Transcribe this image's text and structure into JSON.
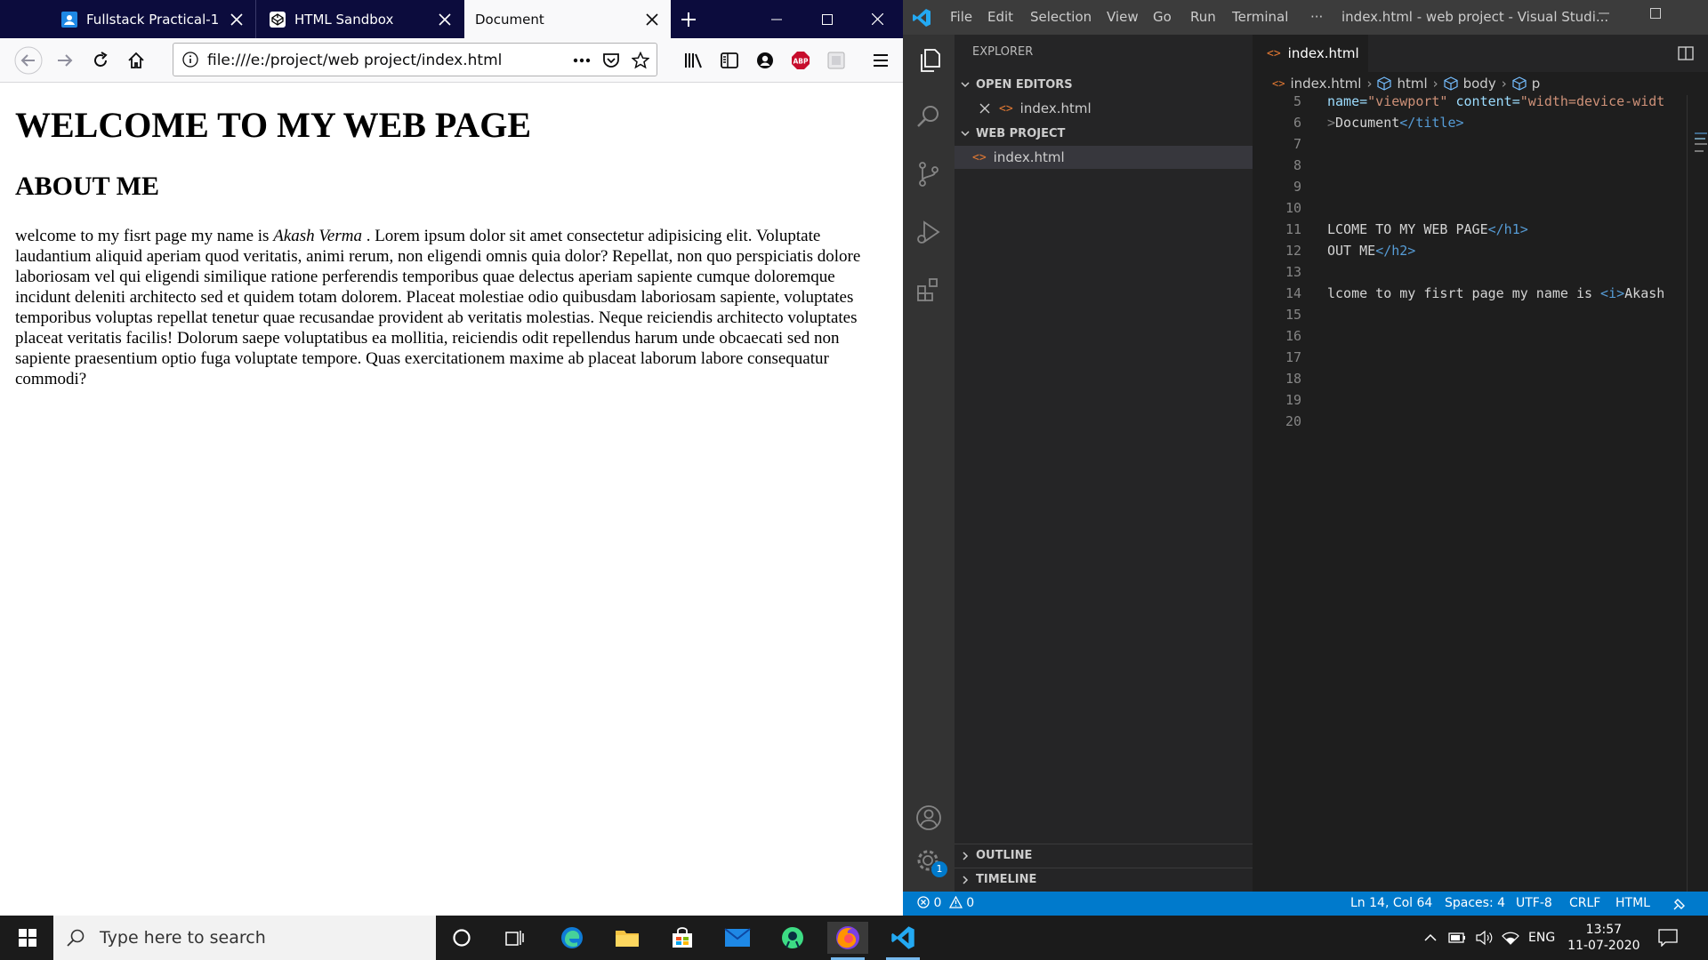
{
  "firefox": {
    "tabs": [
      {
        "title": "Fullstack Practical-1"
      },
      {
        "title": "HTML Sandbox"
      },
      {
        "title": "Document"
      }
    ],
    "url": "file:///e:/project/web project/index.html",
    "page": {
      "h1": "WELCOME TO MY WEB PAGE",
      "h2": "ABOUT ME",
      "para_before": "welcome to my fisrt page my name is ",
      "para_italic": "Akash Verma",
      "para_after": " . Lorem ipsum dolor sit amet consectetur adipisicing elit. Voluptate laudantium aliquid aperiam quod veritatis, animi rerum, non eligendi omnis quia dolor? Repellat, non quo perspiciatis dolore laboriosam vel qui eligendi similique ratione perferendis temporibus quae delectus aperiam sapiente cumque doloremque incidunt deleniti architecto sed et quidem totam dolorem. Placeat molestiae odio quibusdam laboriosam sapiente, voluptates temporibus voluptas repellat tenetur quae recusandae provident ab veritatis molestias. Neque reiciendis architecto voluptates placeat veritatis facilis! Dolorum saepe voluptatibus ea mollitia, reiciendis odit repellendus harum unde obcaecati sed non sapiente praesentium optio fuga voluptate tempore. Quas exercitationem maxime ab placeat laborum labore consequatur commodi?"
    }
  },
  "vscode": {
    "menu": [
      "File",
      "Edit",
      "Selection",
      "View",
      "Go",
      "Run",
      "Terminal"
    ],
    "more": "···",
    "window_title": "index.html - web project - Visual Studi...",
    "explorer": {
      "title": "EXPLORER",
      "open_editors": "OPEN EDITORS",
      "open_file": "index.html",
      "project": "WEB PROJECT",
      "project_file": "index.html",
      "outline": "OUTLINE",
      "timeline": "TIMELINE"
    },
    "tab": "index.html",
    "breadcrumb": [
      "index.html",
      "html",
      "body",
      "p"
    ],
    "code": {
      "l5": "5",
      "l6": "6",
      "l7": "7",
      "l8": "8",
      "l9": "9",
      "l10": "10",
      "l11": "11",
      "l12": "12",
      "l13": "13",
      "l14": "14",
      "l15": "15",
      "l16": "16",
      "l17": "17",
      "l18": "18",
      "l19": "19",
      "l20": "20",
      "c5_attr1": "name=",
      "c5_val1": "\"viewport\"",
      "c5_attr2": " content=",
      "c5_val2": "\"width=device-widt",
      "c6_pun": ">",
      "c6_txt": "Document",
      "c6_tag": "</title>",
      "c6_end": ">",
      "c11_txt": "LCOME TO MY WEB PAGE",
      "c11_tag": "</h1>",
      "c12_txt": "OUT ME",
      "c12_tag": "</h2>",
      "c14_txt": "lcome to my fisrt page my name is ",
      "c14_tag": "<i>",
      "c14_rest": "Akash"
    },
    "status": {
      "errors": "0",
      "warnings": "0",
      "position": "Ln 14, Col 64",
      "spaces": "Spaces: 4",
      "encoding": "UTF-8",
      "eol": "CRLF",
      "language": "HTML"
    },
    "settings_badge": "1"
  },
  "taskbar": {
    "search_placeholder": "Type here to search",
    "lang": "ENG",
    "time": "13:57",
    "date": "11-07-2020"
  }
}
